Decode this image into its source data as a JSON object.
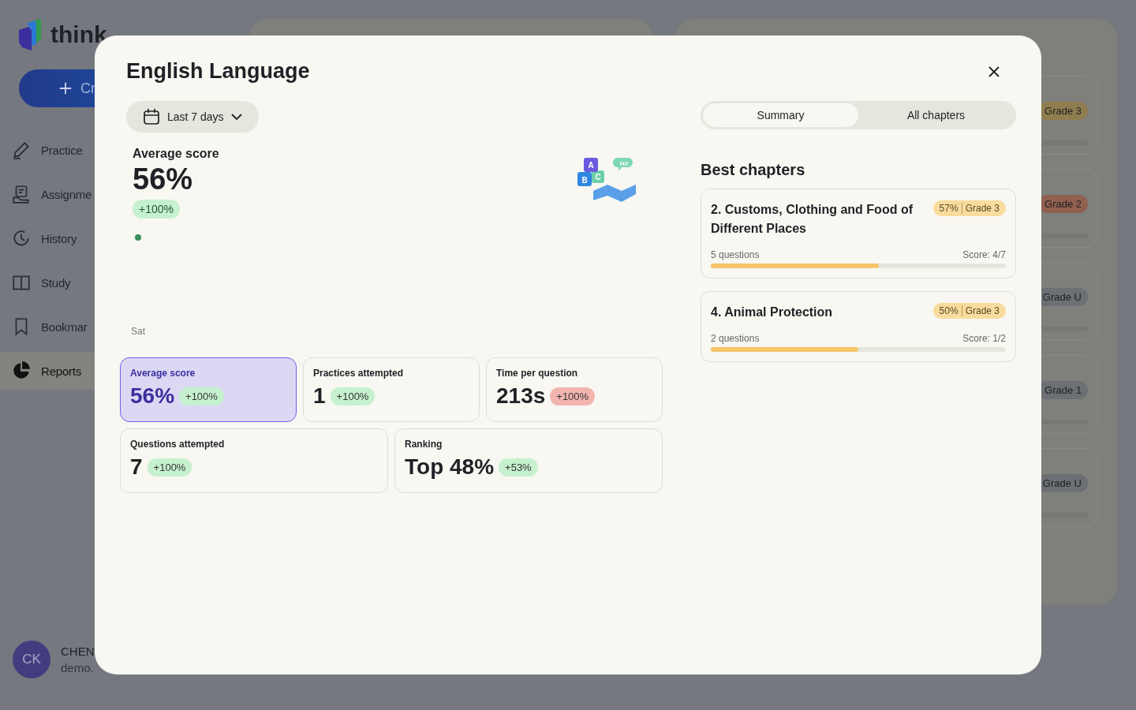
{
  "app": {
    "logo": "think",
    "create_button": "Cr",
    "nav": [
      {
        "label": "Practice",
        "selected": false
      },
      {
        "label": "Assignme",
        "selected": false
      },
      {
        "label": "History",
        "selected": false
      },
      {
        "label": "Study",
        "selected": false
      },
      {
        "label": "Bookmar",
        "selected": false
      },
      {
        "label": "Reports",
        "selected": true
      }
    ],
    "user": {
      "initials": "CK",
      "name": "CHEN",
      "email": "demo."
    },
    "background_cards": [
      {
        "grade": "Grade 3",
        "color": "#8f7d4f"
      },
      {
        "grade": "Grade 2",
        "color": "#91604f"
      },
      {
        "grade": "Grade U",
        "color": "#6c6f73"
      },
      {
        "grade": "Grade 1",
        "color": "#6c6f73"
      },
      {
        "grade": "Grade U",
        "color": "#6c6f73"
      }
    ]
  },
  "modal": {
    "title": "English Language",
    "date_range": "Last 7 days",
    "headline": {
      "label": "Average score",
      "value": "56%",
      "delta": "+100%"
    },
    "chart": {
      "x_label": "Sat"
    },
    "illustration": {
      "letters": [
        "A",
        "B",
        "C"
      ],
      "bubble": "Hi!"
    },
    "stats": [
      {
        "label": "Average score",
        "value": "56%",
        "delta": "+100%",
        "color": "#c6f1cf",
        "selected": true
      },
      {
        "label": "Practices attempted",
        "value": "1",
        "delta": "+100%",
        "color": "#c6f1cf",
        "selected": false
      },
      {
        "label": "Time per question",
        "value": "213s",
        "delta": "+100%",
        "color": "#f2b4ae",
        "selected": false
      },
      {
        "label": "Questions attempted",
        "value": "7",
        "delta": "+100%",
        "color": "#c6f1cf",
        "selected": false
      },
      {
        "label": "Ranking",
        "value": "Top 48%",
        "delta": "+53%",
        "color": "#c6f1cf",
        "selected": false
      }
    ],
    "tabs": [
      {
        "label": "Summary",
        "selected": true
      },
      {
        "label": "All chapters",
        "selected": false
      }
    ],
    "best_chapters": {
      "title": "Best chapters",
      "items": [
        {
          "title": "2. Customs, Clothing and Food of Different Places",
          "percent": "57%",
          "grade": "Grade 3",
          "questions": "5 questions",
          "score": "Score: 4/7",
          "level": 0.57
        },
        {
          "title": "4. Animal Protection",
          "percent": "50%",
          "grade": "Grade 3",
          "questions": "2 questions",
          "score": "Score: 1/2",
          "level": 0.5
        }
      ]
    }
  }
}
